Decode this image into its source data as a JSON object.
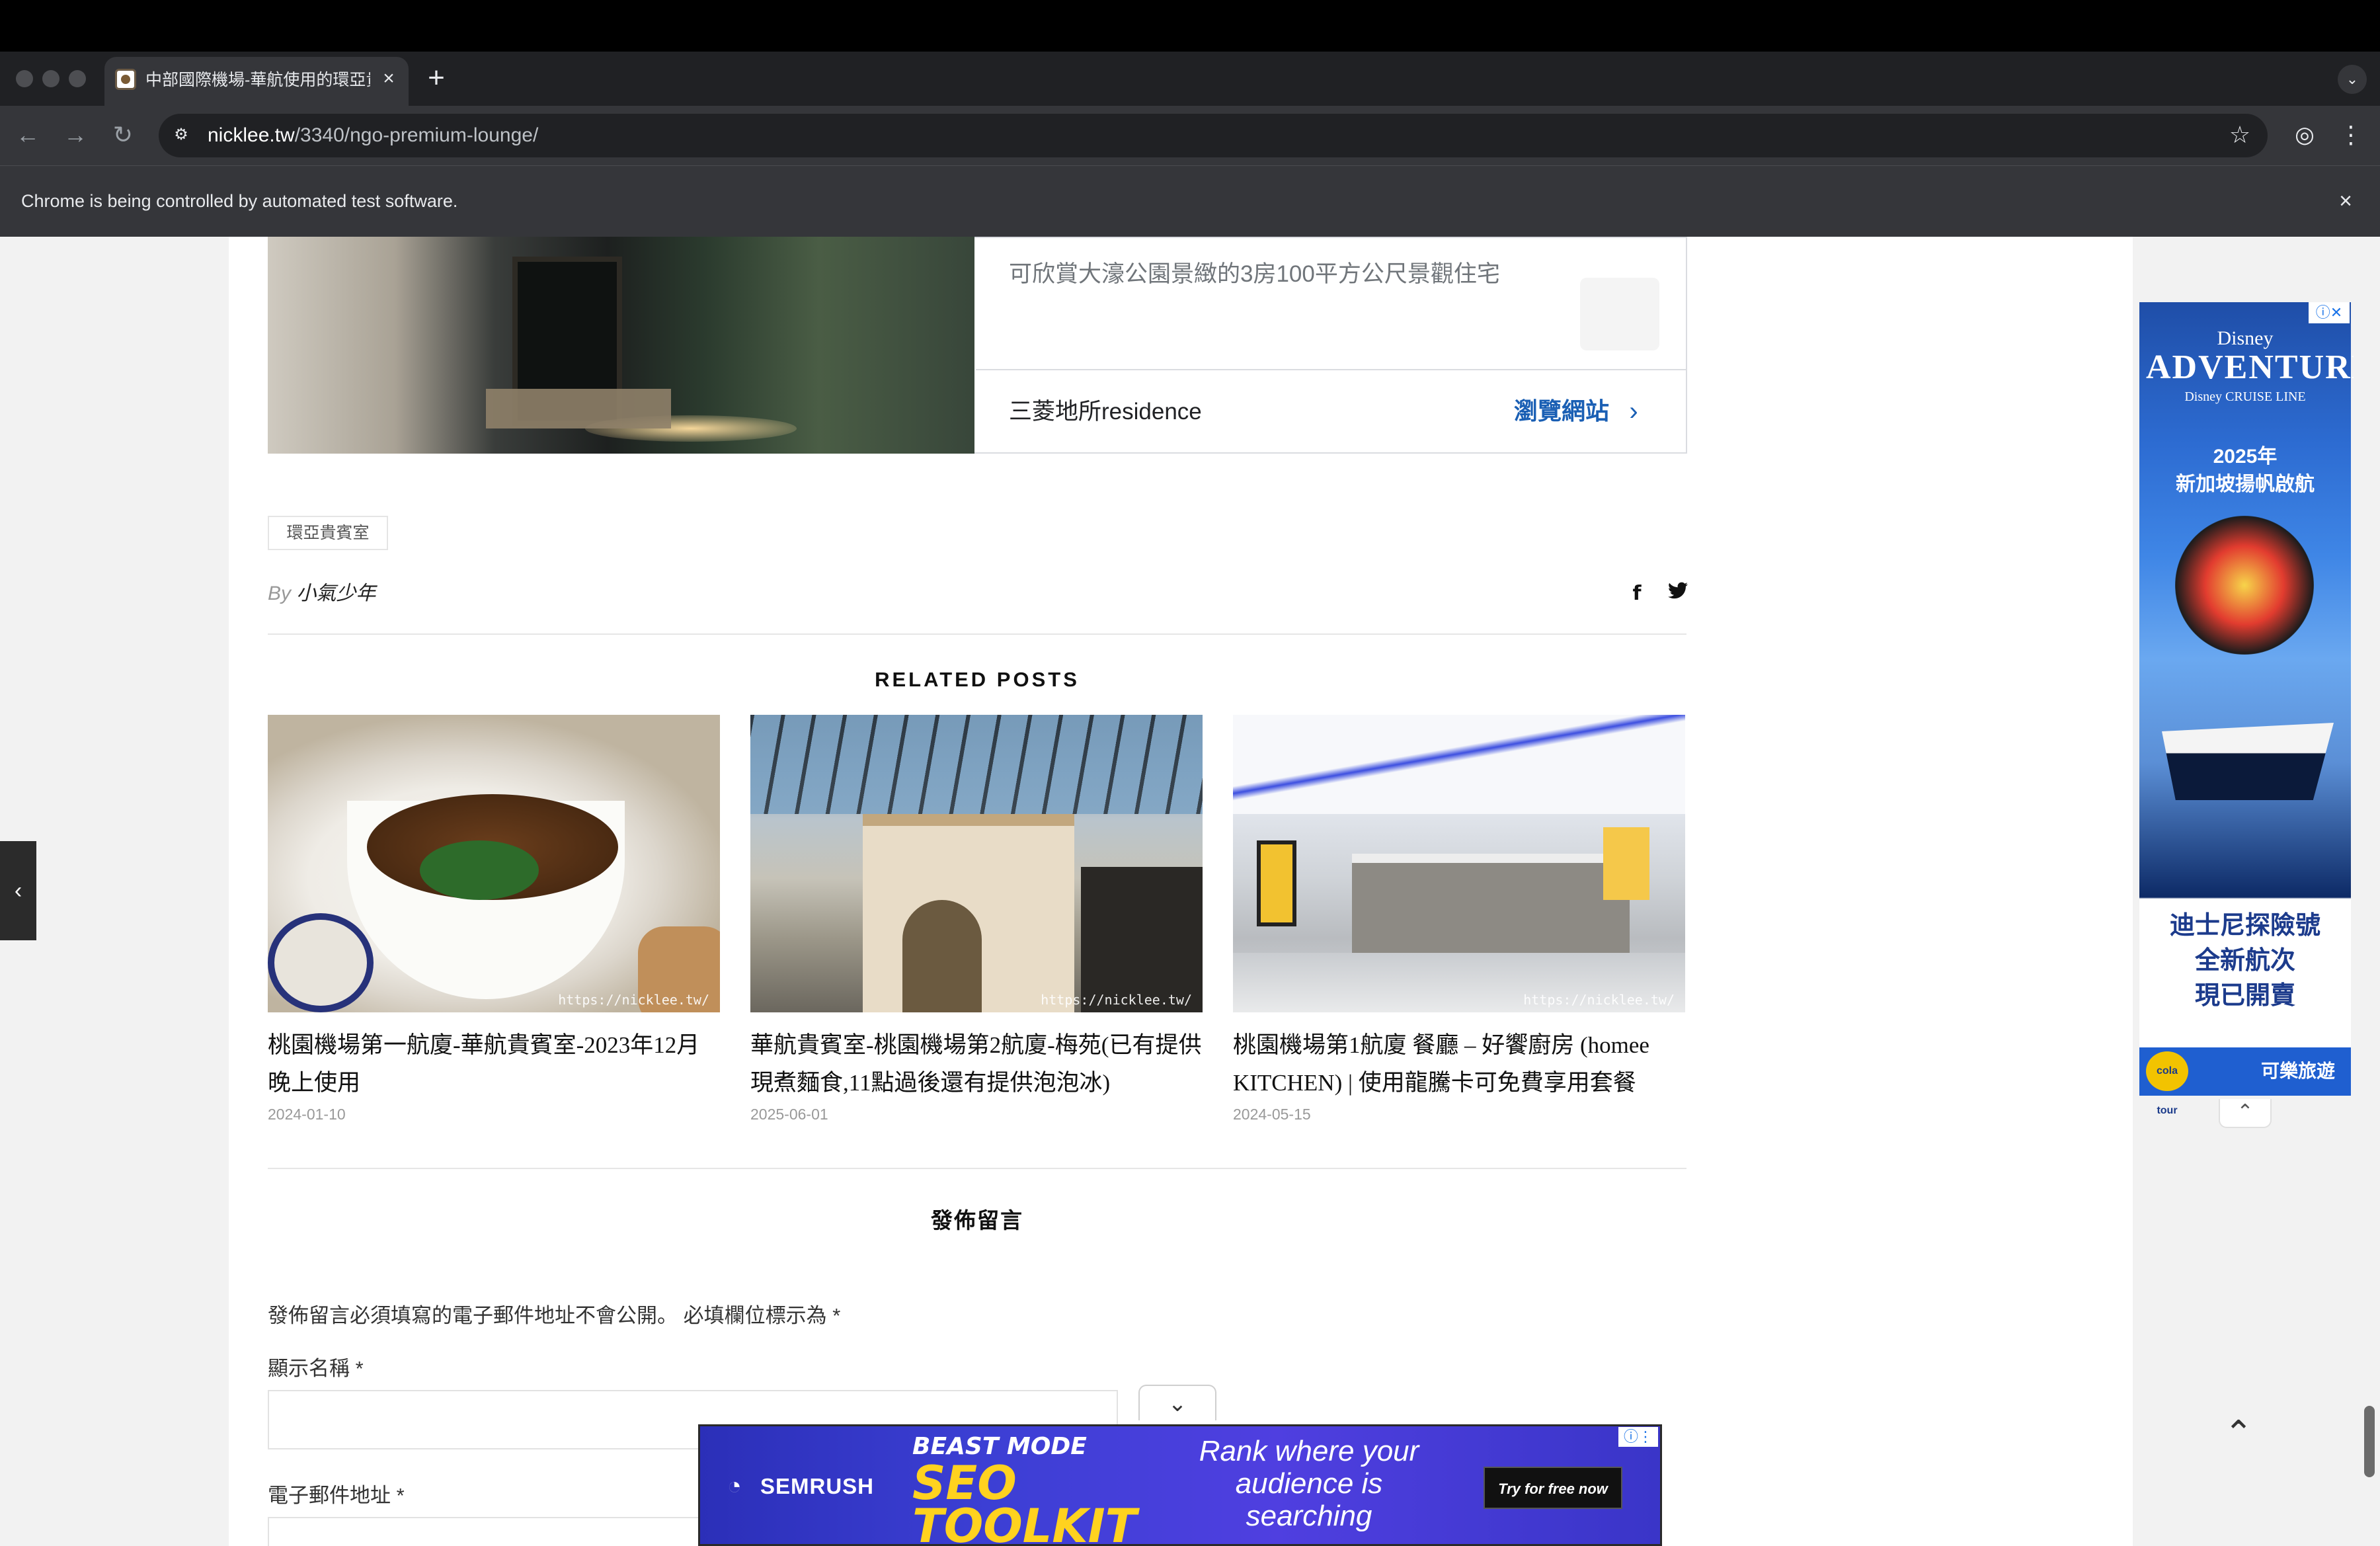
{
  "browser": {
    "tab_title": "中部國際機場-華航使用的環亞貴賓室",
    "url_host": "nicklee.tw",
    "url_path": "/3340/ngo-premium-lounge/",
    "infobar_text": "Chrome is being controlled by automated test software."
  },
  "ad_top": {
    "description": "可欣賞大濠公園景緻的3房100平方公尺景觀住宅",
    "advertiser": "三菱地所residence",
    "cta": "瀏覽網站"
  },
  "post": {
    "tag": "環亞貴賓室",
    "by_prefix": "By",
    "author": "小氣少年"
  },
  "related": {
    "title": "RELATED POSTS",
    "watermark": "https://nicklee.tw/",
    "posts": [
      {
        "title": "桃園機場第一航廈-華航貴賓室-2023年12月晚上使用",
        "date": "2024-01-10"
      },
      {
        "title": "華航貴賓室-桃園機場第2航廈-梅苑(已有提供現煮麵食,11點過後還有提供泡泡冰)",
        "date": "2025-06-01"
      },
      {
        "title": "桃園機場第1航廈 餐廳 – 好饗廚房 (homee KITCHEN) | 使用龍騰卡可免費享用套餐",
        "date": "2024-05-15"
      }
    ]
  },
  "comment": {
    "title": "發佈留言",
    "notes": "發佈留言必須填寫的電子郵件地址不會公開。 必填欄位標示為 *",
    "name_label": "顯示名稱 *",
    "email_label": "電子郵件地址 *"
  },
  "side_ad": {
    "brand_line1": "Disney",
    "brand_line2": "ADVENTURE",
    "brand_line3": "Disney CRUISE LINE",
    "year_line1": "2025年",
    "year_line2": "新加坡揚帆啟航",
    "copy_line1": "迪士尼探險號",
    "copy_line2": "全新航次",
    "copy_line3": "現已開賣",
    "logo_text": "cola tour",
    "footer_brand": "可樂旅遊"
  },
  "anchor_ad": {
    "logo": "SEMRUSH",
    "toolkit_l1": "BEAST MODE",
    "toolkit_l2": "SEO",
    "toolkit_l3": "TOOLKIT",
    "tagline": "Rank where your audience is searching",
    "cta": "Try for free now"
  },
  "icons": {
    "traffic_lights": "window-controls",
    "back": "arrow-left-icon",
    "forward": "arrow-right-icon",
    "reload": "reload-icon",
    "site_info": "tune-icon",
    "bookmark": "star-icon",
    "profile": "profile-icon",
    "menu": "kebab-menu-icon"
  }
}
